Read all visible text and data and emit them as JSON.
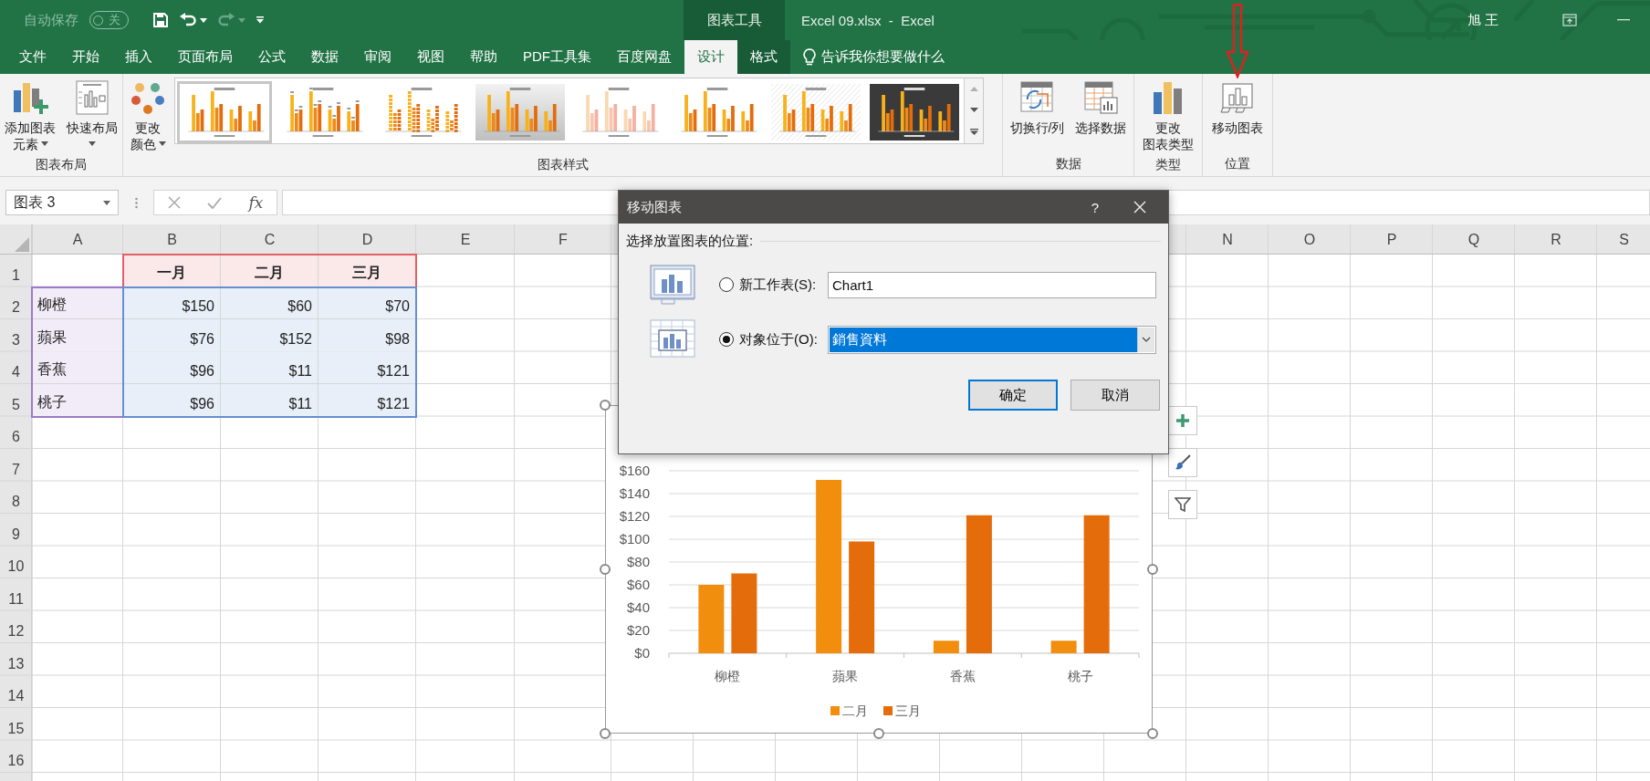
{
  "title_bar": {
    "autosave": {
      "label": "自动保存",
      "on": false,
      "state_text": "关"
    },
    "quick_access": [
      {
        "kind": "save",
        "disabled": false
      },
      {
        "kind": "undo",
        "disabled": false
      },
      {
        "kind": "redo",
        "disabled": true
      },
      {
        "kind": "customize",
        "disabled": false
      }
    ],
    "context_header": "图表工具",
    "title": "Excel 09.xlsx  -  Excel",
    "user": "旭 王"
  },
  "ribbon_tabs": [
    {
      "label": "文件",
      "selected": false,
      "contextual": false
    },
    {
      "label": "开始",
      "selected": false,
      "contextual": false
    },
    {
      "label": "插入",
      "selected": false,
      "contextual": false
    },
    {
      "label": "页面布局",
      "selected": false,
      "contextual": false
    },
    {
      "label": "公式",
      "selected": false,
      "contextual": false
    },
    {
      "label": "数据",
      "selected": false,
      "contextual": false
    },
    {
      "label": "审阅",
      "selected": false,
      "contextual": false
    },
    {
      "label": "视图",
      "selected": false,
      "contextual": false
    },
    {
      "label": "帮助",
      "selected": false,
      "contextual": false
    },
    {
      "label": "PDF工具集",
      "selected": false,
      "contextual": false
    },
    {
      "label": "百度网盘",
      "selected": false,
      "contextual": false
    },
    {
      "label": "设计",
      "selected": true
    },
    {
      "label": "格式",
      "selected": false,
      "contextual": true
    }
  ],
  "tell_me": "告诉我你想要做什么",
  "ribbon_groups": [
    {
      "label": "图表布局",
      "kind": "buttons",
      "buttons": [
        {
          "kind": "add-element",
          "lines": [
            "添加图表",
            "元素"
          ],
          "dropdown": true
        },
        {
          "kind": "quick-layout",
          "lines": [
            "快速布局"
          ],
          "dropdown": true
        }
      ]
    },
    {
      "label": "图表样式",
      "kind": "styles",
      "buttons": [
        {
          "kind": "colors",
          "lines": [
            "更改",
            "颜色"
          ],
          "dropdown": true
        }
      ],
      "styles": [
        {
          "kind": "plain",
          "selected": true
        },
        {
          "kind": "labeled",
          "selected": false
        },
        {
          "kind": "stacked",
          "selected": false
        },
        {
          "kind": "gray",
          "selected": false
        },
        {
          "kind": "pale",
          "selected": false
        },
        {
          "kind": "plain",
          "selected": false
        },
        {
          "kind": "hatched",
          "selected": false
        },
        {
          "kind": "dark",
          "selected": false
        }
      ]
    },
    {
      "label": "数据",
      "kind": "buttons",
      "buttons": [
        {
          "kind": "switch",
          "lines": [
            "切换行/列"
          ],
          "dropdown": false
        },
        {
          "kind": "select-data",
          "lines": [
            "选择数据"
          ],
          "dropdown": false
        }
      ]
    },
    {
      "label": "类型",
      "kind": "buttons",
      "buttons": [
        {
          "kind": "change-type",
          "lines": [
            "更改",
            "图表类型"
          ],
          "dropdown": false
        }
      ]
    },
    {
      "label": "位置",
      "kind": "buttons",
      "buttons": [
        {
          "kind": "move-chart",
          "lines": [
            "移动图表"
          ],
          "dropdown": false
        }
      ]
    }
  ],
  "formula_bar": {
    "name_box": "图表 3",
    "function_label": "fx"
  },
  "sheet": {
    "columns": [
      "A",
      "B",
      "C",
      "D",
      "E",
      "F",
      null,
      null,
      null,
      null,
      null,
      null,
      null,
      "N",
      "O",
      "P",
      "Q",
      "R",
      "S"
    ],
    "rows": [
      {
        "number": "1",
        "cells": {
          "B": {
            "text": "一月",
            "kind": "header",
            "color": "#fbe8e9"
          },
          "C": {
            "text": "二月",
            "kind": "header",
            "color": "#fbe8e9"
          },
          "D": {
            "text": "三月",
            "kind": "header",
            "color": "#fbe8e9"
          }
        }
      },
      {
        "number": "2",
        "cells": {
          "A": {
            "text": "柳橙",
            "kind": "text",
            "color": "#f1ecf7"
          },
          "B": {
            "text": "$150",
            "kind": "number",
            "color": "#e9eff8"
          },
          "C": {
            "text": "$60",
            "kind": "number",
            "color": "#e9eff8"
          },
          "D": {
            "text": "$70",
            "kind": "number",
            "color": "#e9eff8"
          }
        }
      },
      {
        "number": "3",
        "cells": {
          "A": {
            "text": "蘋果",
            "kind": "text",
            "color": "#f1ecf7"
          },
          "B": {
            "text": "$76",
            "kind": "number",
            "color": "#e9eff8"
          },
          "C": {
            "text": "$152",
            "kind": "number",
            "color": "#e9eff8"
          },
          "D": {
            "text": "$98",
            "kind": "number",
            "color": "#e9eff8"
          }
        }
      },
      {
        "number": "4",
        "cells": {
          "A": {
            "text": "香蕉",
            "kind": "text",
            "color": "#f1ecf7"
          },
          "B": {
            "text": "$96",
            "kind": "number",
            "color": "#e9eff8"
          },
          "C": {
            "text": "$11",
            "kind": "number",
            "color": "#e9eff8"
          },
          "D": {
            "text": "$121",
            "kind": "number",
            "color": "#e9eff8"
          }
        }
      },
      {
        "number": "5",
        "cells": {
          "A": {
            "text": "桃子",
            "kind": "text",
            "color": "#f1ecf7"
          },
          "B": {
            "text": "$96",
            "kind": "number",
            "color": "#e9eff8"
          },
          "C": {
            "text": "$11",
            "kind": "number",
            "color": "#e9eff8"
          },
          "D": {
            "text": "$121",
            "kind": "number",
            "color": "#e9eff8"
          }
        }
      },
      {
        "number": "6"
      },
      {
        "number": "7"
      },
      {
        "number": "8"
      },
      {
        "number": "9"
      },
      {
        "number": "10"
      },
      {
        "number": "11"
      },
      {
        "number": "12"
      },
      {
        "number": "13"
      },
      {
        "number": "14"
      },
      {
        "number": "15"
      },
      {
        "number": "16"
      }
    ]
  },
  "chart": {
    "selected": true,
    "side_buttons": [
      {
        "kind": "elements"
      },
      {
        "kind": "styles"
      },
      {
        "kind": "filters"
      }
    ],
    "chart_data": {
      "type": "bar",
      "categories": [
        "柳橙",
        "蘋果",
        "香蕉",
        "桃子"
      ],
      "series": [
        {
          "name": "二月",
          "color": "#f28e0e",
          "values": [
            60,
            152,
            11,
            11
          ]
        },
        {
          "name": "三月",
          "color": "#e46c0a",
          "values": [
            70,
            98,
            121,
            121
          ]
        }
      ],
      "ylim": [
        0,
        160
      ],
      "grid": true,
      "legend": "bottom",
      "yticks": [
        {
          "value": 0,
          "label": "$0"
        },
        {
          "value": 20,
          "label": "$20"
        },
        {
          "value": 40,
          "label": "$40"
        },
        {
          "value": 60,
          "label": "$60"
        },
        {
          "value": 80,
          "label": "$80"
        },
        {
          "value": 100,
          "label": "$100"
        },
        {
          "value": 120,
          "label": "$120"
        },
        {
          "value": 140,
          "label": "$140"
        },
        {
          "value": 160,
          "label": "$160"
        }
      ]
    }
  },
  "dialog": {
    "title": "移动图表",
    "help": "?",
    "section_label": "选择放置图表的位置:",
    "options": [
      {
        "kind": "text",
        "label": "新工作表(S):",
        "selected": false,
        "value": "Chart1"
      },
      {
        "kind": "dropdown",
        "label": "对象位于(O):",
        "selected": true,
        "value": "銷售資料"
      }
    ],
    "buttons": [
      {
        "label": "确定",
        "default": true
      },
      {
        "label": "取消",
        "default": false
      }
    ]
  }
}
